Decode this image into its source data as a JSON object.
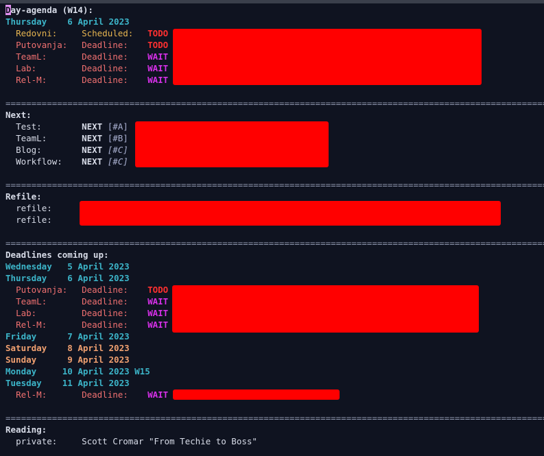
{
  "title_first": "D",
  "title_rest": "ay-agenda (W14):",
  "separator": "=================================================================================================================",
  "today": {
    "date": "Thursday    6 April 2023",
    "items": [
      {
        "category": "Redovni:",
        "kind": "Scheduled:",
        "state": "TODO"
      },
      {
        "category": "Putovanja:",
        "kind": "Deadline:",
        "state": "TODO"
      },
      {
        "category": "TeamL:",
        "kind": "Deadline:",
        "state": "WAIT"
      },
      {
        "category": "Lab:",
        "kind": "Deadline:",
        "state": "WAIT"
      },
      {
        "category": "Rel-M:",
        "kind": "Deadline:",
        "state": "WAIT"
      }
    ]
  },
  "next": {
    "header": "Next:",
    "items": [
      {
        "category": "Test:",
        "state": "NEXT",
        "priority": "[#A]"
      },
      {
        "category": "TeamL:",
        "state": "NEXT",
        "priority": "[#B]"
      },
      {
        "category": "Blog:",
        "state": "NEXT",
        "priority": "[#C]"
      },
      {
        "category": "Workflow:",
        "state": "NEXT",
        "priority": "[#C]"
      }
    ]
  },
  "refile": {
    "header": "Refile:",
    "items": [
      {
        "category": "refile:"
      },
      {
        "category": "refile:"
      }
    ]
  },
  "deadlines": {
    "header": "Deadlines coming up:",
    "day1": "Wednesday   5 April 2023",
    "day2": "Thursday    6 April 2023",
    "day2_items": [
      {
        "category": "Putovanja:",
        "kind": "Deadline:",
        "state": "TODO"
      },
      {
        "category": "TeamL:",
        "kind": "Deadline:",
        "state": "WAIT"
      },
      {
        "category": "Lab:",
        "kind": "Deadline:",
        "state": "WAIT"
      },
      {
        "category": "Rel-M:",
        "kind": "Deadline:",
        "state": "WAIT"
      }
    ],
    "day3": "Friday      7 April 2023",
    "day4": "Saturday    8 April 2023",
    "day5": "Sunday      9 April 2023",
    "day6": "Monday     10 April 2023 W15",
    "day7": "Tuesday    11 April 2023",
    "day7_items": [
      {
        "category": "Rel-M:",
        "kind": "Deadline:",
        "state": "WAIT"
      }
    ]
  },
  "reading": {
    "header": "Reading:",
    "category": "private:",
    "text": "Scott Cromar \"From Techie to Boss\""
  },
  "colors": {
    "background": "#0f1320",
    "todo": "#ff3030",
    "wait": "#d630e8",
    "date": "#3cb4c8",
    "weekend": "#f0a070",
    "redaction": "#ff0000"
  }
}
